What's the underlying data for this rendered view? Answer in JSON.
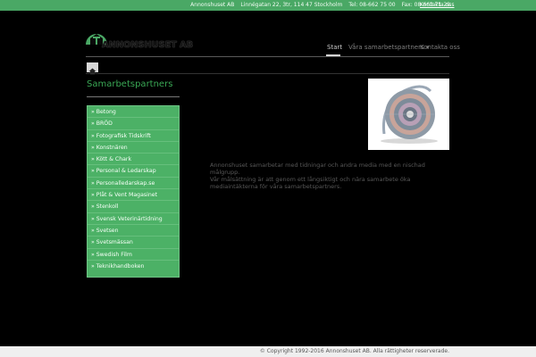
{
  "topbar": {
    "company": "Annonshuset AB",
    "address": "Linnégatan 22, 3tr, 114 47 Stockholm",
    "phone": "Tel: 08-662 75 00",
    "fax": "Fax: 08-662 71 29",
    "contact_link": "Kontakta oss"
  },
  "logo": {
    "text": "ANNONSHUSET AB"
  },
  "nav": {
    "items": [
      {
        "label": "Start"
      },
      {
        "label": "Våra samarbetspartners ▾"
      },
      {
        "label": "Kontakta oss"
      }
    ]
  },
  "breadcrumb": {
    "home_icon": "home-icon"
  },
  "sidebar": {
    "title": "Samarbetspartners",
    "items": [
      {
        "label": "» Betong"
      },
      {
        "label": "» BRÖD"
      },
      {
        "label": "» Fotografisk Tidskrift"
      },
      {
        "label": "» Konstnären"
      },
      {
        "label": "» Kött & Chark"
      },
      {
        "label": "» Personal & Ledarskap"
      },
      {
        "label": "» Personalledarskap.se"
      },
      {
        "label": "» Plåt & Vent Magasinet"
      },
      {
        "label": "» Stenkoll"
      },
      {
        "label": "» Svensk Veterinärtidning"
      },
      {
        "label": "» Svetsen"
      },
      {
        "label": "» Svetsmässan"
      },
      {
        "label": "» Swedish Film"
      },
      {
        "label": "» Teknikhandboken"
      }
    ]
  },
  "main": {
    "intro_line1": "Annonshuset samarbetar med tidningar och andra media med en nischad målgrupp.",
    "intro_line2": "Vår målsättning är att genom ett långsiktigt och nära samarbete öka mediaintäkterna för våra samarbetspartners."
  },
  "footer": {
    "copyright": "© Copyright 1992-2016 Annonshuset AB. Alla rättigheter reserverade."
  },
  "colors": {
    "brand_green": "#4aa865",
    "background": "#000000"
  }
}
